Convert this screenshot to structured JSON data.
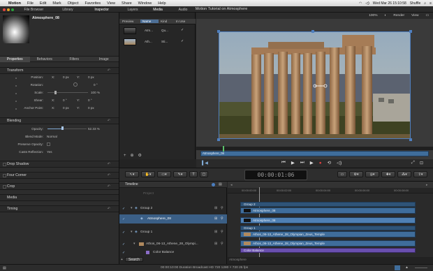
{
  "menubar": {
    "app": "Motion",
    "items": [
      "File",
      "Edit",
      "Mark",
      "Object",
      "Favorites",
      "View",
      "Share",
      "Window",
      "Help"
    ],
    "window_title": "Motion Tutorial on Atmosphere",
    "clock": "Wed Mar 26  15:10:58",
    "user": "Shuffle"
  },
  "top_tabs": {
    "left": [
      "File Browser",
      "Library",
      "Inspector"
    ],
    "middle": [
      "Layers",
      "Media",
      "Audio"
    ]
  },
  "inspector": {
    "preview_title": "Atmosphere_08",
    "tabs": [
      "Properties",
      "Behaviors",
      "Filters",
      "Image"
    ],
    "sections": [
      "Transform",
      "Blending",
      "Drop Shadow",
      "Four Corner",
      "Crop",
      "Media",
      "Timing"
    ],
    "transform": {
      "position": {
        "label": "Position:",
        "x_label": "X:",
        "x": "0 px",
        "y_label": "Y:",
        "y": "0 px"
      },
      "rotation": {
        "label": "Rotation:",
        "value": "0 °"
      },
      "scale": {
        "label": "Scale:",
        "value": "100 %"
      },
      "shear": {
        "label": "Shear:",
        "x_label": "X:",
        "x": "0 °",
        "y_label": "Y:",
        "y": "0 °"
      },
      "anchor": {
        "label": "Anchor Point:",
        "x_label": "X:",
        "x": "0 px",
        "y_label": "Y:",
        "y": "0 px"
      }
    },
    "blending": {
      "opacity_label": "Opacity:",
      "opacity": "52.33 %",
      "blend_label": "Blend Mode:",
      "blend": "Normal",
      "preserve_label": "Preserve Opacity:",
      "casts_label": "Casts Reflection:",
      "casts": "Yes"
    }
  },
  "media_list": {
    "columns": [
      "Preview",
      "Name",
      "Kind",
      "In Use"
    ],
    "rows": [
      {
        "name": "Atm...",
        "kind": "Qu..."
      },
      {
        "name": "Ath...",
        "kind": "Sti..."
      }
    ]
  },
  "canvas": {
    "zoom": "100%",
    "render": "Render",
    "view": "View",
    "mini_label": "Atmosphere_08"
  },
  "timecode": "00:00:01:06",
  "timeline": {
    "header": "Timeline",
    "project": "Project",
    "layers": [
      "Group 2",
      "Atmosphere_08",
      "Group 1",
      "Athos_06-13_Athene_28_Olympi...",
      "Color Balance"
    ],
    "ruler": [
      "00:00:00:00",
      "00:00:02:00",
      "00:00:04:00",
      "00:00:06:00",
      "00:00:08:00"
    ],
    "clips": {
      "group2": "Group 2",
      "atm1": "Atmosphere_08",
      "atm2": "Atmosphere_08",
      "group1": "Group 1",
      "ath1": "Athos_06-13_Athene_28_Olympian_Zeus_Temple",
      "ath2": "Athos_06-13_Athene_28_Olympian_Zeus_Temple",
      "cb": "Color Balance"
    },
    "search_label": "Search",
    "bottom_text": "Atmosphere"
  },
  "status": {
    "info": "00:00:10:00 Duration  Broadcast HD 720  1280 × 720  25 fps"
  }
}
